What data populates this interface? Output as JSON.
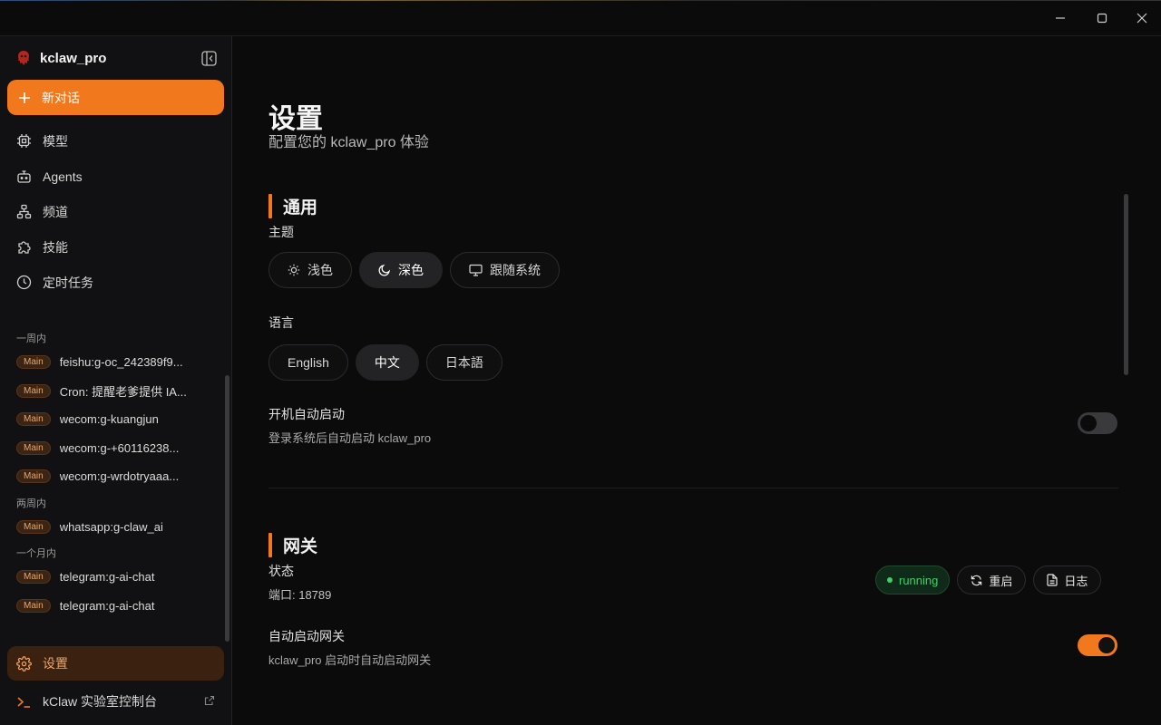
{
  "window": {
    "minimize_icon": "minimize-icon",
    "maximize_icon": "maximize-icon",
    "close_icon": "close-icon"
  },
  "sidebar": {
    "brand": "kclaw_pro",
    "new_chat": "新对话",
    "nav": [
      {
        "label": "模型",
        "icon": "chip-icon"
      },
      {
        "label": "Agents",
        "icon": "bot-icon"
      },
      {
        "label": "频道",
        "icon": "network-icon"
      },
      {
        "label": "技能",
        "icon": "puzzle-icon"
      },
      {
        "label": "定时任务",
        "icon": "clock-icon"
      }
    ],
    "history": {
      "week_label": "一周内",
      "week": [
        {
          "badge": "Main",
          "title": "feishu:g-oc_242389f9..."
        },
        {
          "badge": "Main",
          "title": "Cron: 提醒老爹提供 IA..."
        },
        {
          "badge": "Main",
          "title": "wecom:g-kuangjun"
        },
        {
          "badge": "Main",
          "title": "wecom:g-+60116238..."
        },
        {
          "badge": "Main",
          "title": "wecom:g-wrdotryaaa..."
        }
      ],
      "two_weeks_label": "两周内",
      "two_weeks": [
        {
          "badge": "Main",
          "title": "whatsapp:g-claw_ai"
        }
      ],
      "month_label": "一个月内",
      "month": [
        {
          "badge": "Main",
          "title": "telegram:g-ai-chat"
        },
        {
          "badge": "Main",
          "title": "telegram:g-ai-chat"
        }
      ]
    },
    "settings": "设置",
    "console": "kClaw 实验室控制台"
  },
  "main": {
    "title": "设置",
    "subtitle": "配置您的 kclaw_pro 体验",
    "general": {
      "heading": "通用",
      "theme_label": "主题",
      "themes": [
        {
          "label": "浅色",
          "icon": "sun-icon",
          "active": false
        },
        {
          "label": "深色",
          "icon": "moon-icon",
          "active": true
        },
        {
          "label": "跟随系统",
          "icon": "monitor-icon",
          "active": false
        }
      ],
      "language_label": "语言",
      "languages": [
        {
          "label": "English",
          "active": false
        },
        {
          "label": "中文",
          "active": true
        },
        {
          "label": "日本語",
          "active": false
        }
      ],
      "autostart_label": "开机自动启动",
      "autostart_desc": "登录系统后自动启动 kclaw_pro",
      "autostart_on": false
    },
    "gateway": {
      "heading": "网关",
      "status_label": "状态",
      "port_text": "端口: 18789",
      "status_value": "running",
      "restart": "重启",
      "logs": "日志",
      "auto_label": "自动启动网关",
      "auto_desc": "kclaw_pro 启动时自动启动网关",
      "auto_on": true
    }
  },
  "colors": {
    "accent": "#f2781e",
    "running": "#3ecf6a",
    "background": "#0b0b0c",
    "sidebar": "#111113"
  }
}
